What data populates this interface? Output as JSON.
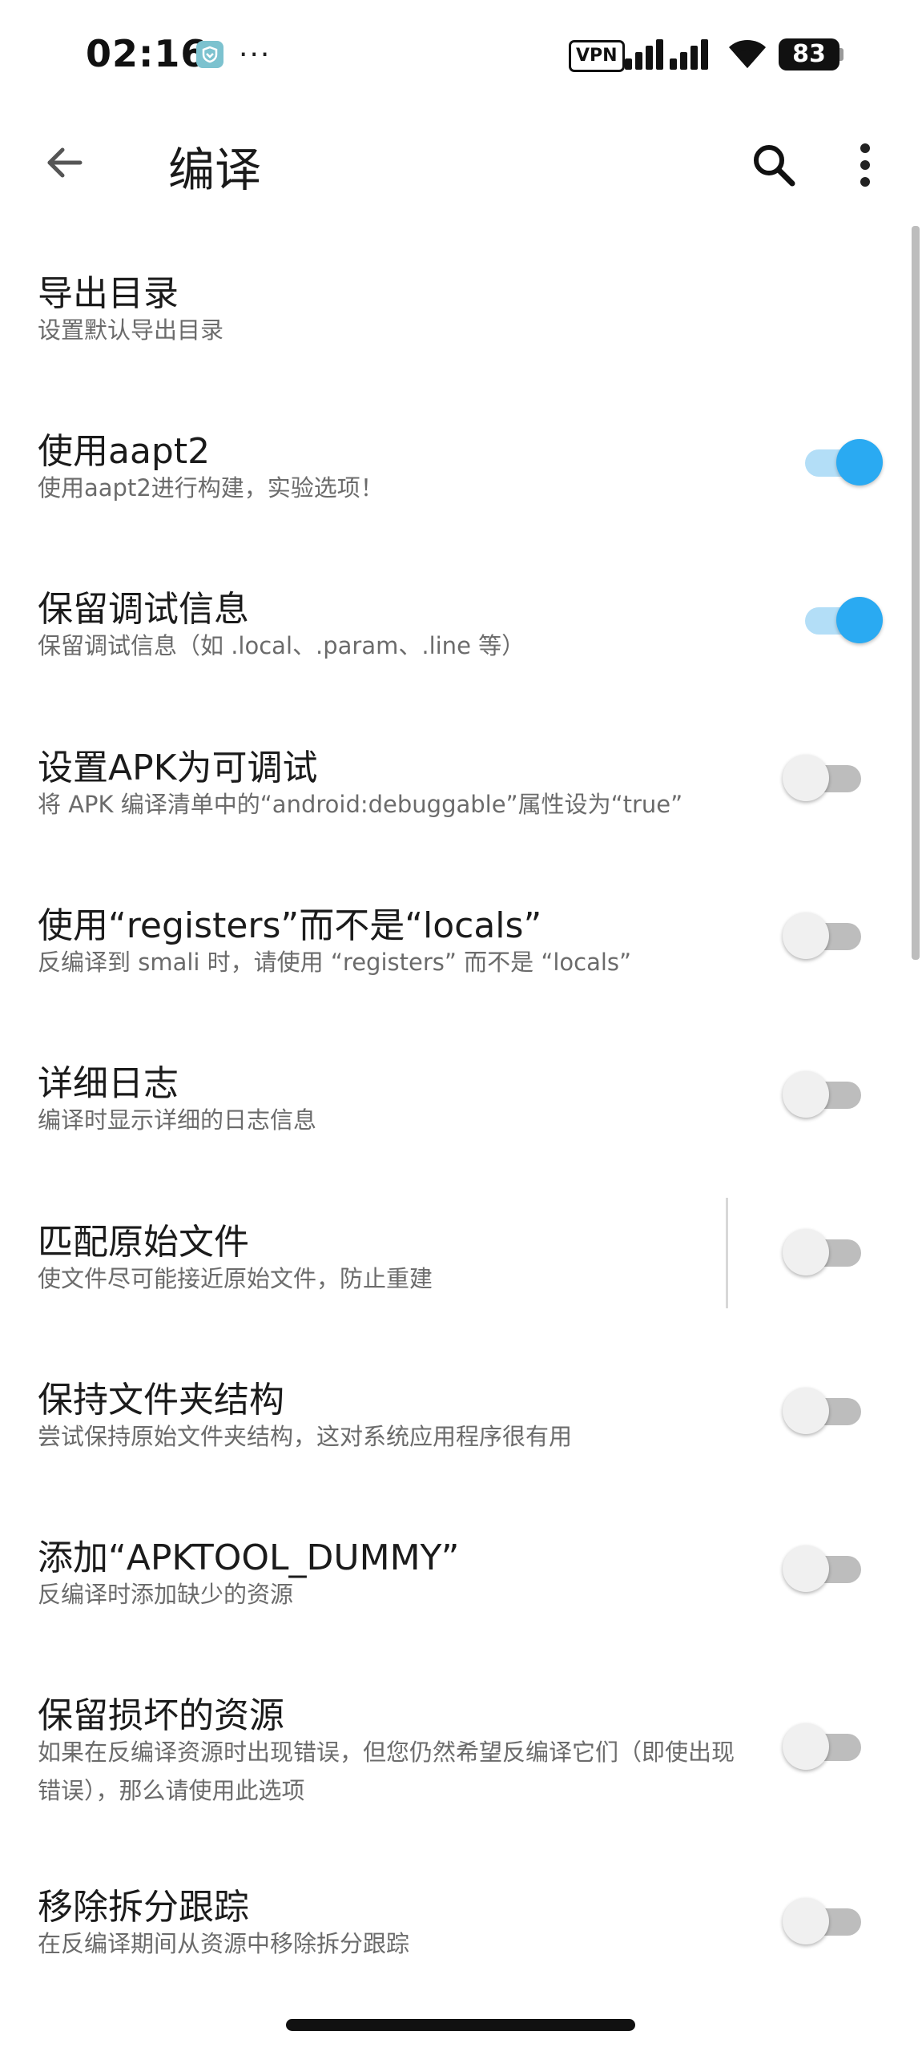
{
  "status_bar": {
    "time": "02:16",
    "more_notifications": "···",
    "vpn": "VPN",
    "battery": "83"
  },
  "toolbar": {
    "title": "编译"
  },
  "settings": [
    {
      "title": "导出目录",
      "summary": "设置默认导出目录",
      "has_switch": false
    },
    {
      "title": "使用aapt2",
      "summary": "使用aapt2进行构建，实验选项！",
      "has_switch": true,
      "enabled": true
    },
    {
      "title": "保留调试信息",
      "summary": "保留调试信息（如 .local、.param、.line 等）",
      "has_switch": true,
      "enabled": true
    },
    {
      "title": "设置APK为可调试",
      "summary": "将 APK 编译清单中的“android:debuggable”属性设为“true”",
      "has_switch": true,
      "enabled": false
    },
    {
      "title": "使用“registers”而不是“locals”",
      "summary": "反编译到 smali 时，请使用 “registers” 而不是 “locals”",
      "has_switch": true,
      "enabled": false
    },
    {
      "title": "详细日志",
      "summary": "编译时显示详细的日志信息",
      "has_switch": true,
      "enabled": false
    },
    {
      "title": "匹配原始文件",
      "summary": "使文件尽可能接近原始文件，防止重建",
      "has_switch": true,
      "enabled": false
    },
    {
      "title": "保持文件夹结构",
      "summary": "尝试保持原始文件夹结构，这对系统应用程序很有用",
      "has_switch": true,
      "enabled": false
    },
    {
      "title": "添加“APKTOOL_DUMMY”",
      "summary": "反编译时添加缺少的资源",
      "has_switch": true,
      "enabled": false
    },
    {
      "title": "保留损坏的资源",
      "summary": "如果在反编译资源时出现错误，但您仍然希望反编译它们（即使出现错误），那么请使用此选项",
      "has_switch": true,
      "enabled": false
    },
    {
      "title": "移除拆分跟踪",
      "summary": "在反编译期间从资源中移除拆分跟踪",
      "has_switch": true,
      "enabled": false
    }
  ],
  "colors": {
    "accent": "#2aaaf2",
    "accent_track": "#b3def7",
    "title_text": "#1b1b1b",
    "summary_text": "#6b6b6b"
  },
  "icons": [
    "shield-app-icon",
    "signal-icon",
    "wifi-icon",
    "back-arrow-icon",
    "search-icon",
    "more-vert-icon"
  ]
}
